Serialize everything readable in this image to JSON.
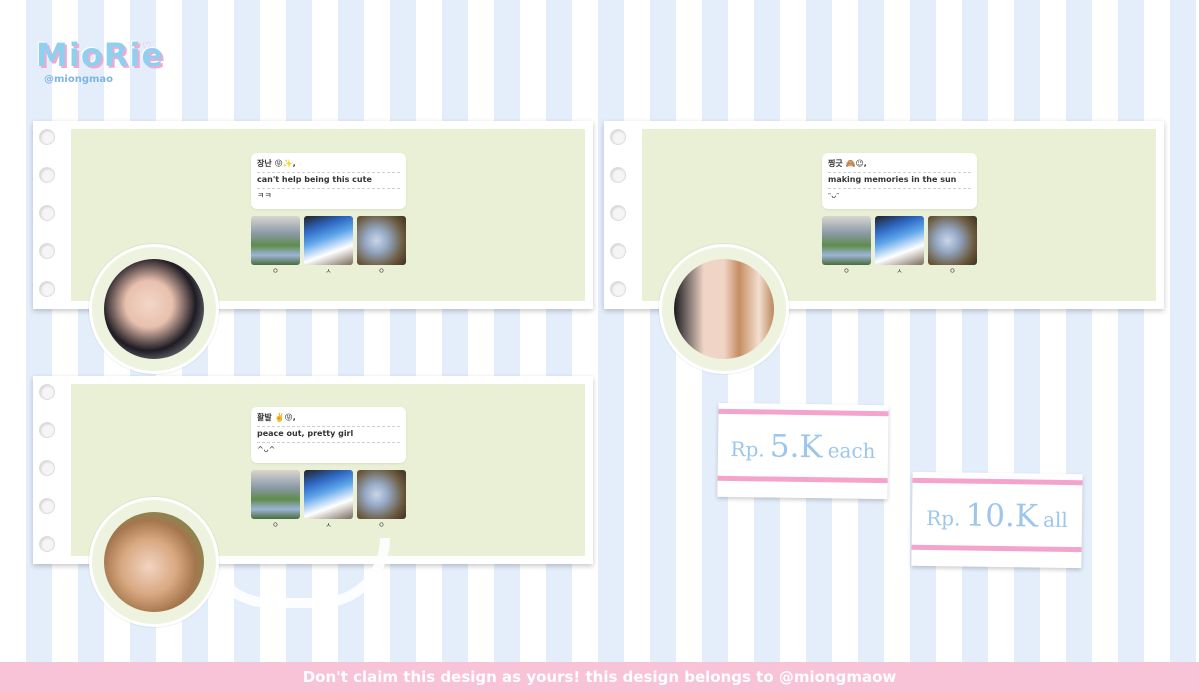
{
  "brand": {
    "logo_text": "MioRie",
    "logo_handle": "@miongmao",
    "hearts": "♡♡"
  },
  "cards": [
    {
      "lines": [
        "장난 😝✨,",
        "can't help being this cute",
        "ㅋㅋ"
      ],
      "captions": [
        "ㅇ",
        "ㅅ",
        "ㅇ"
      ]
    },
    {
      "lines": [
        "찡긋 🙈😉,",
        "making memories in the sun",
        "ᵔᴗᵔ"
      ],
      "captions": [
        "ㅇ",
        "ㅅ",
        "ㅇ"
      ]
    },
    {
      "lines": [
        "활발 ✌️😝,",
        "peace out, pretty girl",
        "^ᴗ^"
      ],
      "captions": [
        "ㅇ",
        "ㅅ",
        "ㅇ"
      ]
    }
  ],
  "prices": [
    {
      "prefix": "Rp.",
      "amount": "5.K",
      "suffix": "each"
    },
    {
      "prefix": "Rp.",
      "amount": "10.K",
      "suffix": "all"
    }
  ],
  "footer": {
    "text": "Don't claim this design as yours! this design belongs to @miongmaow"
  },
  "colors": {
    "green_panel": "#eaf0d6",
    "stripe_blue": "#e4eefb",
    "pink": "#f4a4cc",
    "price_text": "#9dc6ec",
    "footer_bg": "#f8c3d7"
  }
}
